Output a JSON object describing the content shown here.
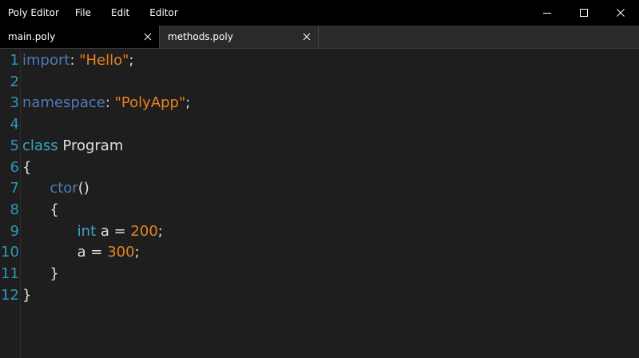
{
  "titlebar": {
    "app_title": "Poly Editor",
    "menu": [
      {
        "label": "File"
      },
      {
        "label": "Edit"
      },
      {
        "label": "Editor"
      }
    ],
    "icons": [
      "minimize-icon",
      "maximize-icon",
      "close-icon"
    ]
  },
  "tabs": [
    {
      "label": "main.poly",
      "active": true
    },
    {
      "label": "methods.poly",
      "active": false
    }
  ],
  "colors": {
    "keyword": "#4f79b8",
    "type": "#3ba6c8",
    "string": "#e8841e",
    "number": "#e8841e",
    "line_number": "#2f96b8",
    "background": "#1e1e1e"
  },
  "editor": {
    "lines": [
      {
        "num": "1",
        "tokens": [
          [
            "kw",
            "import"
          ],
          [
            "plain",
            ": "
          ],
          [
            "str",
            "\"Hello\""
          ],
          [
            "plain",
            ";"
          ]
        ]
      },
      {
        "num": "2",
        "tokens": []
      },
      {
        "num": "3",
        "tokens": [
          [
            "kw",
            "namespace"
          ],
          [
            "plain",
            ": "
          ],
          [
            "str",
            "\"PolyApp\""
          ],
          [
            "plain",
            ";"
          ]
        ]
      },
      {
        "num": "4",
        "tokens": []
      },
      {
        "num": "5",
        "tokens": [
          [
            "type",
            "class"
          ],
          [
            "plain",
            " Program"
          ]
        ]
      },
      {
        "num": "6",
        "tokens": [
          [
            "plain",
            "{"
          ]
        ]
      },
      {
        "num": "7",
        "tokens": [
          [
            "plain",
            "      "
          ],
          [
            "kw",
            "ctor"
          ],
          [
            "plain",
            "()"
          ]
        ]
      },
      {
        "num": "8",
        "tokens": [
          [
            "plain",
            "      {"
          ]
        ]
      },
      {
        "num": "9",
        "tokens": [
          [
            "plain",
            "            "
          ],
          [
            "type",
            "int"
          ],
          [
            "plain",
            " a = "
          ],
          [
            "num",
            "200"
          ],
          [
            "plain",
            ";"
          ]
        ]
      },
      {
        "num": "10",
        "tokens": [
          [
            "plain",
            "            a = "
          ],
          [
            "num",
            "300"
          ],
          [
            "plain",
            ";"
          ]
        ]
      },
      {
        "num": "11",
        "tokens": [
          [
            "plain",
            "      }"
          ]
        ]
      },
      {
        "num": "12",
        "tokens": [
          [
            "plain",
            "}"
          ]
        ]
      }
    ]
  }
}
